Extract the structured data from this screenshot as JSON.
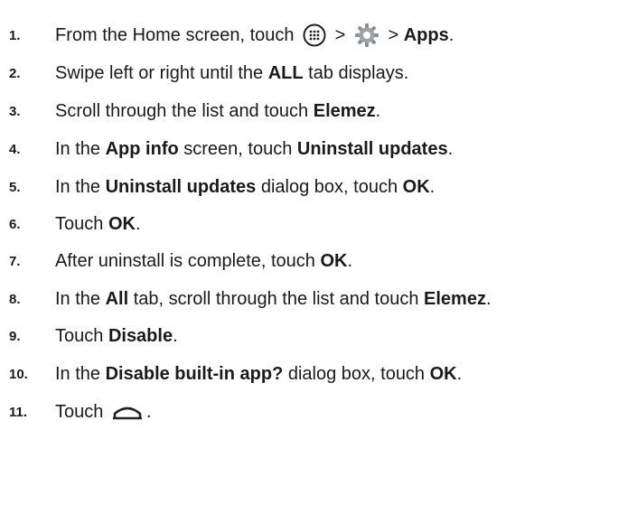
{
  "steps": [
    {
      "number": "1.",
      "parts": [
        {
          "t": "text",
          "v": "From the Home screen, touch "
        },
        {
          "t": "icon",
          "name": "apps-icon"
        },
        {
          "t": "text",
          "v": " > "
        },
        {
          "t": "icon",
          "name": "settings-gear-icon"
        },
        {
          "t": "text",
          "v": " > "
        },
        {
          "t": "bold",
          "v": "Apps"
        },
        {
          "t": "text",
          "v": "."
        }
      ]
    },
    {
      "number": "2.",
      "parts": [
        {
          "t": "text",
          "v": "Swipe left or right until the "
        },
        {
          "t": "bold",
          "v": "ALL"
        },
        {
          "t": "text",
          "v": " tab displays."
        }
      ]
    },
    {
      "number": "3.",
      "parts": [
        {
          "t": "text",
          "v": "Scroll through the list and touch "
        },
        {
          "t": "bold",
          "v": "Elemez"
        },
        {
          "t": "text",
          "v": "."
        }
      ]
    },
    {
      "number": "4.",
      "parts": [
        {
          "t": "text",
          "v": "In the "
        },
        {
          "t": "bold",
          "v": "App info"
        },
        {
          "t": "text",
          "v": " screen, touch "
        },
        {
          "t": "bold",
          "v": "Uninstall updates"
        },
        {
          "t": "text",
          "v": "."
        }
      ]
    },
    {
      "number": "5.",
      "parts": [
        {
          "t": "text",
          "v": "In the "
        },
        {
          "t": "bold",
          "v": "Uninstall updates"
        },
        {
          "t": "text",
          "v": " dialog box, touch "
        },
        {
          "t": "bold",
          "v": "OK"
        },
        {
          "t": "text",
          "v": "."
        }
      ]
    },
    {
      "number": "6.",
      "parts": [
        {
          "t": "text",
          "v": "Touch "
        },
        {
          "t": "bold",
          "v": "OK"
        },
        {
          "t": "text",
          "v": "."
        }
      ]
    },
    {
      "number": "7.",
      "parts": [
        {
          "t": "text",
          "v": "After uninstall is complete, touch "
        },
        {
          "t": "bold",
          "v": "OK"
        },
        {
          "t": "text",
          "v": "."
        }
      ]
    },
    {
      "number": "8.",
      "parts": [
        {
          "t": "text",
          "v": "In the "
        },
        {
          "t": "bold",
          "v": "All"
        },
        {
          "t": "text",
          "v": " tab, scroll through the list and touch "
        },
        {
          "t": "bold",
          "v": "Elemez"
        },
        {
          "t": "text",
          "v": "."
        }
      ]
    },
    {
      "number": "9.",
      "parts": [
        {
          "t": "text",
          "v": "Touch "
        },
        {
          "t": "bold",
          "v": "Disable"
        },
        {
          "t": "text",
          "v": "."
        }
      ]
    },
    {
      "number": "10.",
      "parts": [
        {
          "t": "text",
          "v": "In the "
        },
        {
          "t": "bold",
          "v": "Disable built-in app?"
        },
        {
          "t": "text",
          "v": " dialog box, touch "
        },
        {
          "t": "bold",
          "v": "OK"
        },
        {
          "t": "text",
          "v": "."
        }
      ]
    },
    {
      "number": "11.",
      "parts": [
        {
          "t": "text",
          "v": "Touch "
        },
        {
          "t": "icon",
          "name": "home-icon"
        },
        {
          "t": "text",
          "v": "."
        }
      ]
    }
  ]
}
